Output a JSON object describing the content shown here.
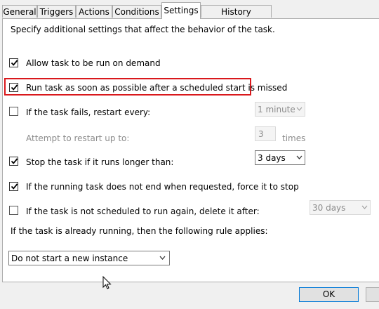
{
  "tabs": [
    {
      "label": "General"
    },
    {
      "label": "Triggers"
    },
    {
      "label": "Actions"
    },
    {
      "label": "Conditions"
    },
    {
      "label": "Settings",
      "active": true
    },
    {
      "label": "History (disabled)"
    }
  ],
  "description": "Specify additional settings that affect the behavior of the task.",
  "options": {
    "allow_on_demand": {
      "label": "Allow task to be run on demand",
      "checked": true
    },
    "run_asap": {
      "label": "Run task as soon as possible after a scheduled start is missed",
      "checked": true
    },
    "restart_on_fail": {
      "label": "If the task fails, restart every:",
      "checked": false,
      "interval": "1 minute"
    },
    "restart_attempts": {
      "label": "Attempt to restart up to:",
      "value": "3",
      "unit": "times"
    },
    "stop_if_longer": {
      "label": "Stop the task if it runs longer than:",
      "checked": true,
      "duration": "3 days"
    },
    "force_stop": {
      "label": "If the running task does not end when requested, force it to stop",
      "checked": true
    },
    "delete_after": {
      "label": "If the task is not scheduled to run again, delete it after:",
      "checked": false,
      "duration": "30 days"
    }
  },
  "rule": {
    "label": "If the task is already running, then the following rule applies:",
    "value": "Do not start a new instance"
  },
  "footer": {
    "ok_label": "OK"
  },
  "colors": {
    "highlight": "#d9181c",
    "accent": "#0078d7"
  }
}
